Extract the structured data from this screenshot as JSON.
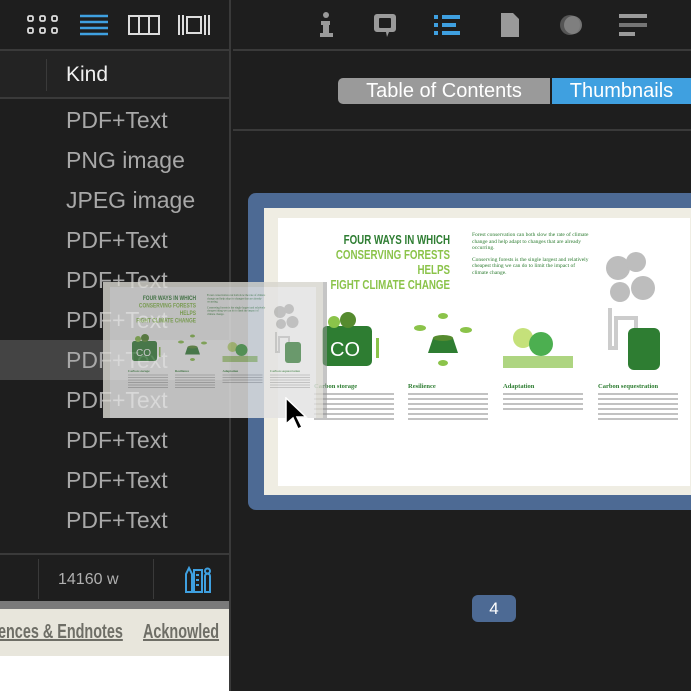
{
  "left_toolbar": {
    "icons": [
      "grid-view-icon",
      "list-view-icon",
      "column-view-icon",
      "gallery-view-icon"
    ],
    "active": "list-view-icon"
  },
  "file_list": {
    "column_header": "Kind",
    "rows": [
      "PDF+Text",
      "PNG image",
      "JPEG image",
      "PDF+Text",
      "PDF+Text",
      "PDF+Text",
      "PDF+Text",
      "PDF+Text",
      "PDF+Text",
      "PDF+Text",
      "PDF+Text"
    ],
    "selected_index": 6
  },
  "status_bar": {
    "word_count": "14160 w",
    "icon": "tools-icon"
  },
  "nav_strip": {
    "items": [
      "ences & Endnotes",
      "Acknowled"
    ]
  },
  "inspector_toolbar": {
    "icons": [
      "info-icon",
      "comment-icon",
      "outline-icon",
      "document-icon",
      "appearance-icon",
      "text-format-icon"
    ],
    "active": "outline-icon"
  },
  "segmented": {
    "toc": "Table of Contents",
    "thumbnails": "Thumbnails",
    "selected": "Thumbnails"
  },
  "thumbnail": {
    "page_number": "4",
    "title_lines": [
      "FOUR WAYS IN WHICH",
      "CONSERVING FORESTS HELPS",
      "FIGHT CLIMATE CHANGE"
    ],
    "intro": [
      "Forest conservation can both slow the rate of climate change and help adapt to changes that are already occurring.",
      "Conserving forests is the single largest and relatively cheapest thing we can do to limit the impact of climate change."
    ],
    "sections": [
      "Carbon storage",
      "Resilience",
      "Adaptation",
      "Carbon sequestration"
    ]
  },
  "colors": {
    "accent": "#3fa0e0",
    "frame": "#4d6a94",
    "green": "#2e7d32",
    "light_green": "#8bc34a"
  }
}
